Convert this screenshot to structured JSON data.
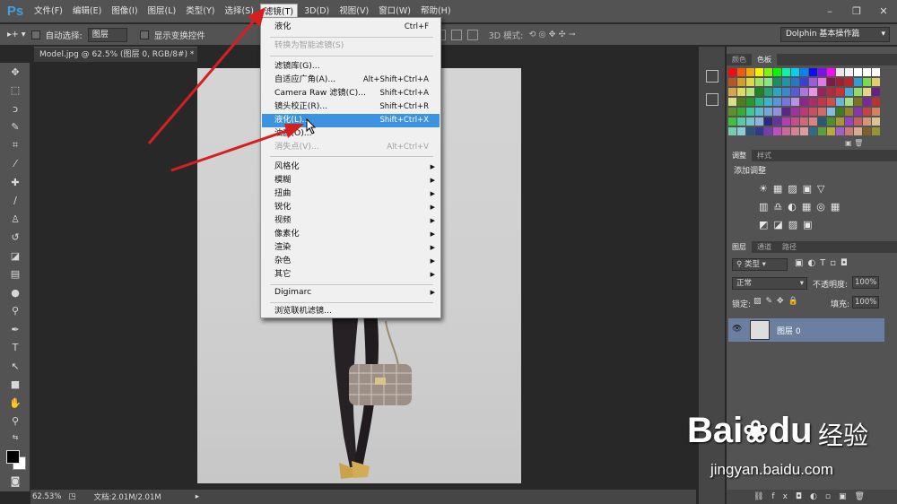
{
  "app": {
    "logo": "Ps"
  },
  "menubar": {
    "items": [
      "文件(F)",
      "编辑(E)",
      "图像(I)",
      "图层(L)",
      "类型(Y)",
      "选择(S)",
      "滤镜(T)",
      "3D(D)",
      "视图(V)",
      "窗口(W)",
      "帮助(H)"
    ],
    "active_index": 6
  },
  "options": {
    "auto_select_label": "自动选择:",
    "auto_select_value": "图层",
    "show_transform_label": "显示变换控件",
    "mode_3d_label": "3D 模式:",
    "workspace": "Dolphin 基本操作篇"
  },
  "document": {
    "tab_title": "Model.jpg @ 62.5% (图层 0, RGB/8#) *",
    "zoom": "62.53%",
    "doc_info": "文档:2.01M/2.01M"
  },
  "filter_menu": {
    "items": [
      {
        "label": "液化",
        "shortcut": "Ctrl+F",
        "state": "normal"
      },
      {
        "label": "转换为智能滤镜(S)",
        "shortcut": "",
        "state": "disabled"
      },
      {
        "label": "滤镜库(G)...",
        "shortcut": "",
        "state": "normal"
      },
      {
        "label": "自适应广角(A)...",
        "shortcut": "Alt+Shift+Ctrl+A",
        "state": "normal"
      },
      {
        "label": "Camera Raw 滤镜(C)...",
        "shortcut": "Shift+Ctrl+A",
        "state": "normal"
      },
      {
        "label": "镜头校正(R)...",
        "shortcut": "Shift+Ctrl+R",
        "state": "normal"
      },
      {
        "label": "液化(L)...",
        "shortcut": "Shift+Ctrl+X",
        "state": "hover"
      },
      {
        "label": "油画(O)...",
        "shortcut": "",
        "state": "normal"
      },
      {
        "label": "消失点(V)...",
        "shortcut": "Alt+Ctrl+V",
        "state": "disabled"
      },
      {
        "label": "风格化",
        "shortcut": "",
        "state": "submenu"
      },
      {
        "label": "模糊",
        "shortcut": "",
        "state": "submenu"
      },
      {
        "label": "扭曲",
        "shortcut": "",
        "state": "submenu"
      },
      {
        "label": "锐化",
        "shortcut": "",
        "state": "submenu"
      },
      {
        "label": "视频",
        "shortcut": "",
        "state": "submenu"
      },
      {
        "label": "像素化",
        "shortcut": "",
        "state": "submenu"
      },
      {
        "label": "渲染",
        "shortcut": "",
        "state": "submenu"
      },
      {
        "label": "杂色",
        "shortcut": "",
        "state": "submenu"
      },
      {
        "label": "其它",
        "shortcut": "",
        "state": "submenu"
      },
      {
        "label": "Digimarc",
        "shortcut": "",
        "state": "submenu"
      },
      {
        "label": "浏览联机滤镜...",
        "shortcut": "",
        "state": "normal"
      }
    ]
  },
  "panels": {
    "color_tabs": [
      "颜色",
      "色板"
    ],
    "adjust_tabs": [
      "调整",
      "样式"
    ],
    "adjust_title": "添加调整",
    "layers_tabs": [
      "图层",
      "通道",
      "路径"
    ],
    "kind_filter": "类型",
    "blend_mode": "正常",
    "opacity_label": "不透明度:",
    "opacity_value": "100%",
    "lock_label": "锁定:",
    "fill_label": "填充:",
    "fill_value": "100%",
    "layer_name": "图层 0"
  },
  "watermark": {
    "brand": "Bai",
    "brand2": "du",
    "brand_cn": "经验",
    "url": "jingyan.baidu.com"
  },
  "colors": {
    "accent": "#3d93e0",
    "arrow": "#d42020",
    "panel": "#535353"
  }
}
